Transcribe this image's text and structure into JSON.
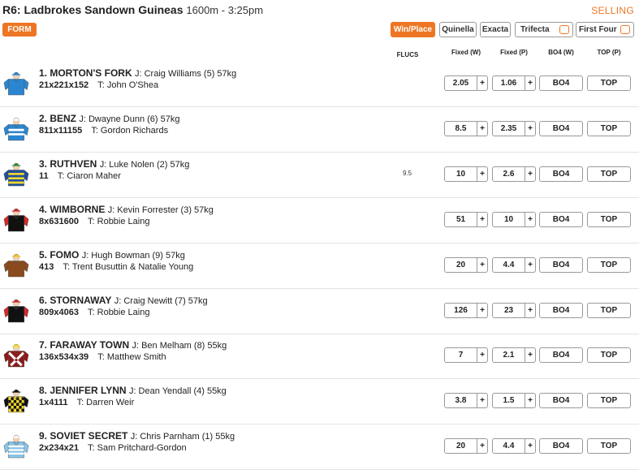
{
  "header": {
    "race_num": "R6:",
    "race_name": "Ladbrokes Sandown Guineas",
    "distance_time": "1600m - 3:25pm",
    "selling": "SELLING"
  },
  "form_btn": "FORM",
  "bet_types": [
    {
      "label": "Win/Place",
      "active": true
    },
    {
      "label": "Quinella",
      "active": false
    },
    {
      "label": "Exacta",
      "active": false
    },
    {
      "label": "Trifecta",
      "active": false,
      "checkbox": true
    },
    {
      "label": "First Four",
      "active": false,
      "checkbox": true
    }
  ],
  "columns": {
    "flucs": "FLUCS",
    "fixed_w": "Fixed (W)",
    "fixed_p": "Fixed (P)",
    "bo4_w": "BO4 (W)",
    "top_p": "TOP (P)"
  },
  "runners": [
    {
      "name": "1. MORTON'S FORK",
      "jockey": "J: Craig Williams (5) 57kg",
      "form": "21x221x152",
      "trainer": "T: John O'Shea",
      "fluc": "",
      "win": "2.05",
      "place": "1.06",
      "plus": "+",
      "bo4": "BO4",
      "top": "TOP",
      "silk": {
        "body": "#2a86d0",
        "sleeve": "#2a86d0",
        "cap": "#2a86d0",
        "pattern": "plain"
      }
    },
    {
      "name": "2. BENZ",
      "jockey": "J: Dwayne Dunn (6) 57kg",
      "form": "811x11155",
      "trainer": "T: Gordon Richards",
      "fluc": "",
      "win": "8.5",
      "place": "2.35",
      "plus": "+",
      "bo4": "BO4",
      "top": "TOP",
      "silk": {
        "body": "#2a86d0",
        "sleeve": "#2a86d0",
        "cap": "#ffffff",
        "pattern": "whitebands"
      }
    },
    {
      "name": "3. RUTHVEN",
      "jockey": "J: Luke Nolen (2) 57kg",
      "form": "11",
      "trainer": "T: Ciaron Maher",
      "fluc": "9.5",
      "win": "10",
      "place": "2.6",
      "plus": "+",
      "bo4": "BO4",
      "top": "TOP",
      "silk": {
        "body": "#1e4f9c",
        "sleeve": "#1e4f9c",
        "cap": "#3a8a3a",
        "pattern": "yellowhoops"
      }
    },
    {
      "name": "4. WIMBORNE",
      "jockey": "J: Kevin Forrester (3) 57kg",
      "form": "8x631600",
      "trainer": "T: Robbie Laing",
      "fluc": "",
      "win": "51",
      "place": "10",
      "plus": "+",
      "bo4": "BO4",
      "top": "TOP",
      "silk": {
        "body": "#111111",
        "sleeve": "#d42a2a",
        "cap": "#d42a2a",
        "pattern": "redsleeves"
      }
    },
    {
      "name": "5. FOMO",
      "jockey": "J: Hugh Bowman (9) 57kg",
      "form": "413",
      "trainer": "T: Trent Busuttin & Natalie Young",
      "fluc": "",
      "win": "20",
      "place": "4.4",
      "plus": "+",
      "bo4": "BO4",
      "top": "TOP",
      "silk": {
        "body": "#8a4a1e",
        "sleeve": "#8a4a1e",
        "cap": "#f2c230",
        "pattern": "plain"
      }
    },
    {
      "name": "6. STORNAWAY",
      "jockey": "J: Craig Newitt (7) 57kg",
      "form": "809x4063",
      "trainer": "T: Robbie Laing",
      "fluc": "",
      "win": "126",
      "place": "23",
      "plus": "+",
      "bo4": "BO4",
      "top": "TOP",
      "silk": {
        "body": "#111111",
        "sleeve": "#d42a2a",
        "cap": "#d42a2a",
        "pattern": "redsleeves"
      }
    },
    {
      "name": "7. FARAWAY TOWN",
      "jockey": "J: Ben Melham (8) 55kg",
      "form": "136x534x39",
      "trainer": "T: Matthew Smith",
      "fluc": "",
      "win": "7",
      "place": "2.1",
      "plus": "+",
      "bo4": "BO4",
      "top": "TOP",
      "silk": {
        "body": "#8c1a1a",
        "sleeve": "#8c1a1a",
        "cap": "#f2e230",
        "pattern": "crossbelts"
      }
    },
    {
      "name": "8. JENNIFER LYNN",
      "jockey": "J: Dean Yendall (4) 55kg",
      "form": "1x4111",
      "trainer": "T: Darren Weir",
      "fluc": "",
      "win": "3.8",
      "place": "1.5",
      "plus": "+",
      "bo4": "BO4",
      "top": "TOP",
      "silk": {
        "body": "#f2d830",
        "sleeve": "#111111",
        "cap": "#111111",
        "pattern": "checks"
      }
    },
    {
      "name": "9. SOVIET SECRET",
      "jockey": "J: Chris Parnham (1) 55kg",
      "form": "2x234x21",
      "trainer": "T: Sam Pritchard-Gordon",
      "fluc": "",
      "win": "20",
      "place": "4.4",
      "plus": "+",
      "bo4": "BO4",
      "top": "TOP",
      "silk": {
        "body": "#8ac4e6",
        "sleeve": "#8ac4e6",
        "cap": "#ffffff",
        "pattern": "whitehoops"
      }
    }
  ]
}
